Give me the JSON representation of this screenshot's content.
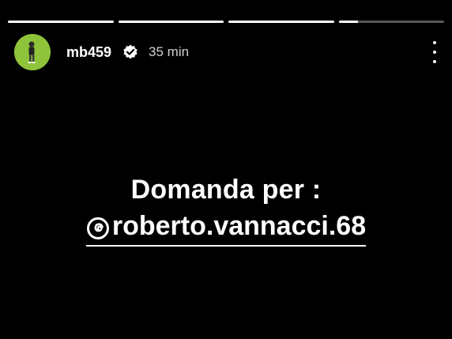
{
  "story": {
    "progress_segments": [
      1,
      1,
      1,
      0.18
    ],
    "username": "mb459",
    "time": "35 min",
    "verified": true
  },
  "content": {
    "line1": "Domanda per :",
    "mention": "roberto.vannacci.68"
  },
  "icons": {
    "verified": "verified-badge-icon",
    "more": "more-vertical-icon",
    "threads": "threads-icon"
  },
  "colors": {
    "background": "#000000",
    "text": "#ffffff",
    "avatar_bg": "#8fc43a"
  }
}
